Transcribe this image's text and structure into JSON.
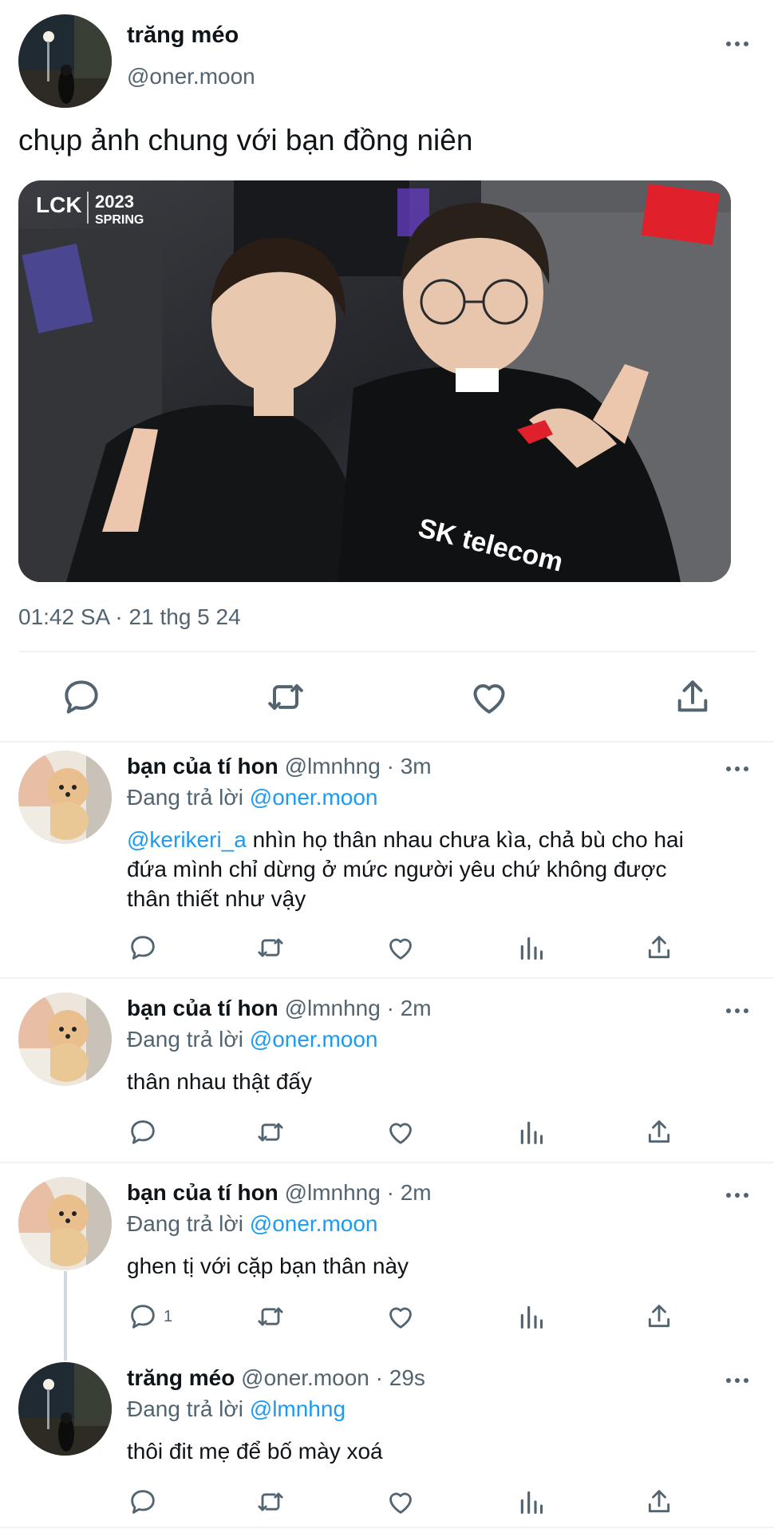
{
  "main_tweet": {
    "name": "trăng méo",
    "handle": "@oner.moon",
    "text": "chụp ảnh chung với bạn đồng niên",
    "photo": {
      "badge_line1": "2023",
      "badge_line2": "SPRING",
      "logo": "LCK"
    },
    "timestamp": "01:42 SA · 21 thg 5 24",
    "actions": [
      "reply-icon",
      "retweet-icon",
      "like-icon",
      "share-icon"
    ]
  },
  "replies": [
    {
      "name": "bạn của tí hon",
      "handle": "@lmnhng",
      "dot": "·",
      "time": "3m",
      "replying_prefix": "Đang trả lời",
      "replying_to": "@oner.moon",
      "mention": "@kerikeri_a",
      "text_line1": " nhìn họ thân nhau chưa kìa, chả bù cho hai",
      "text_line2": "đứa mình chỉ dừng ở mức người yêu chứ không được",
      "text_line3": "thân thiết như vậy",
      "reply_count": ""
    },
    {
      "name": "bạn của tí hon",
      "handle": "@lmnhng",
      "dot": "·",
      "time": "2m",
      "replying_prefix": "Đang trả lời",
      "replying_to": "@oner.moon",
      "text": "thân nhau thật đấy",
      "reply_count": ""
    },
    {
      "name": "bạn của tí hon",
      "handle": "@lmnhng",
      "dot": "·",
      "time": "2m",
      "replying_prefix": "Đang trả lời",
      "replying_to": "@oner.moon",
      "text": "ghen tị với cặp bạn thân này",
      "reply_count": "1"
    },
    {
      "name": "trăng méo",
      "handle": "@oner.moon",
      "dot": "·",
      "time": "29s",
      "replying_prefix": "Đang trả lời",
      "replying_to": "@lmnhng",
      "text": "thôi đit mẹ để bố mày xoá",
      "reply_count": ""
    }
  ],
  "colors": {
    "accent": "#1d9bf0",
    "text": "#0f1419",
    "muted": "#536471",
    "divider": "#eff3f4",
    "badge_red": "#e0202a"
  }
}
